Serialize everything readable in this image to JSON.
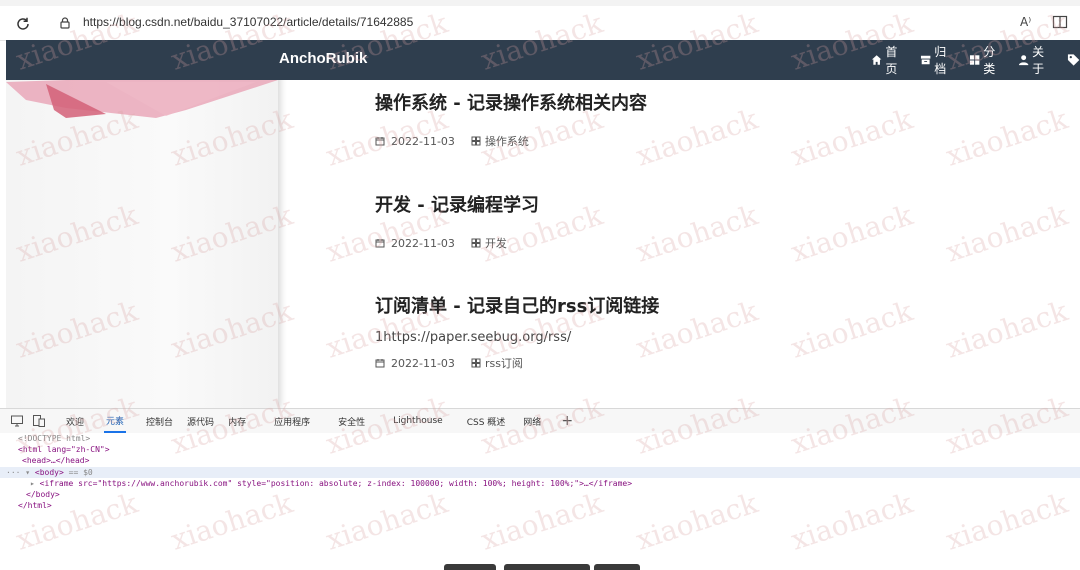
{
  "browser": {
    "url": "https://blog.csdn.net/baidu_37107022/article/details/71642885",
    "read_aloud": "A⁾"
  },
  "site": {
    "brand": "AnchoRubik",
    "nav": [
      {
        "label": "首页",
        "icon": "home-icon"
      },
      {
        "label": "归档",
        "icon": "archive-icon"
      },
      {
        "label": "分类",
        "icon": "category-icon"
      },
      {
        "label": "关于",
        "icon": "user-icon"
      }
    ]
  },
  "posts": [
    {
      "title": "操作系统 - 记录操作系统相关内容",
      "date": "2022-11-03",
      "category": "操作系统",
      "excerpt": ""
    },
    {
      "title": "开发 - 记录编程学习",
      "date": "2022-11-03",
      "category": "开发",
      "excerpt": ""
    },
    {
      "title": "订阅清单 - 记录自己的rss订阅链接",
      "date": "2022-11-03",
      "category": "rss订阅",
      "excerpt": "1https://paper.seebug.org/rss/"
    }
  ],
  "devtools": {
    "tabs": [
      "欢迎",
      "元素",
      "控制台",
      "源代码",
      "内存",
      "应用程序",
      "安全性",
      "Lighthouse",
      "CSS 概述",
      "网络"
    ],
    "active_tab": "元素",
    "code": {
      "doctype": "<!DOCTYPE html>",
      "html_open": "<html lang=\"zh-CN\">",
      "head": "<head>…</head>",
      "body_open": "<body>",
      "body_marker": "== $0",
      "iframe": "<iframe src=\"https://www.anchorubik.com\" style=\"position: absolute; z-index: 100000; width: 100%; height: 100%;\">…</iframe>",
      "body_close": "</body>",
      "html_close": "</html>"
    }
  },
  "watermark": "xiaohack",
  "colors": {
    "navbar": "#2f3e4e",
    "active_tab": "#1a73e8"
  }
}
